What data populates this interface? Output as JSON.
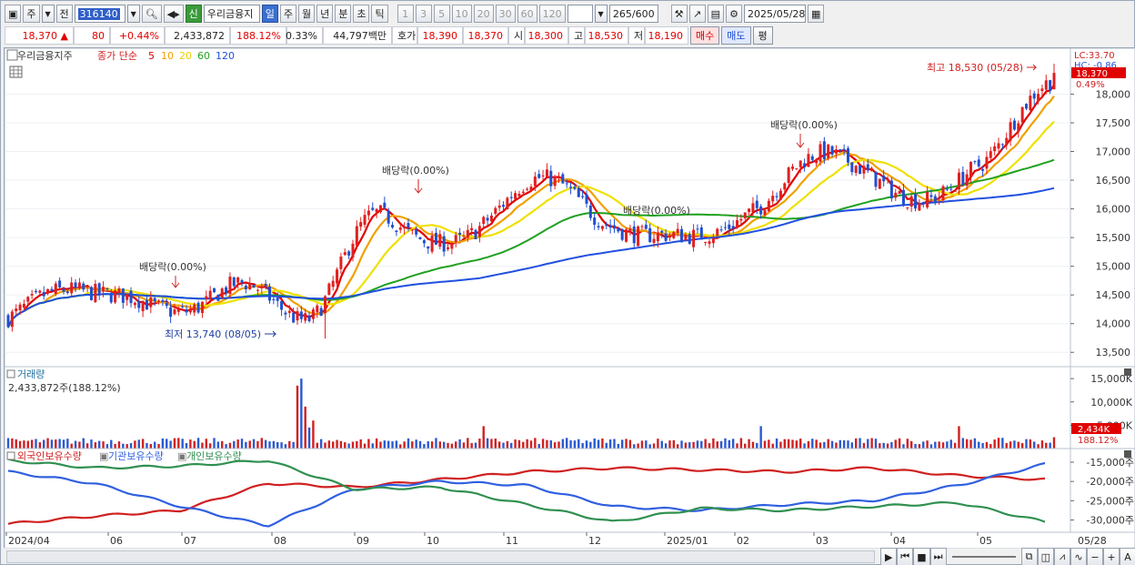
{
  "toolbar": {
    "period_weekly": "주",
    "view_all": "전",
    "stock_code": "316140",
    "new_tag": "신",
    "stock_name": "우리금융지",
    "periods": [
      "일",
      "주",
      "월",
      "년",
      "분",
      "초",
      "틱"
    ],
    "minutes": [
      "1",
      "3",
      "5",
      "10",
      "20",
      "30",
      "60",
      "120"
    ],
    "count": "265",
    "count_total": "/600",
    "date": "2025/05/28"
  },
  "quote": {
    "price": "18,370",
    "change_arrow": "▲",
    "change": "80",
    "change_pct": "+0.44%",
    "volume": "2,433,872",
    "volume_ratio": "188.12%",
    "turnover_pct": "0.33%",
    "amount": "44,797백만",
    "bid_label": "호가",
    "bid1": "18,390",
    "bid2": "18,370",
    "open_label": "시",
    "open": "18,300",
    "high_label": "고",
    "high": "18,530",
    "low_label": "저",
    "low": "18,190",
    "buy_label": "매수",
    "sell_label": "매도",
    "avg_label": "평"
  },
  "price_panel": {
    "legend_name": "우리금융지주",
    "legend_type": "종가 단순",
    "ma_labels": [
      "5",
      "10",
      "20",
      "60",
      "120"
    ],
    "ma_colors": [
      "#e00000",
      "#f0a000",
      "#f0e000",
      "#20a020",
      "#2050e0"
    ],
    "corner_lc": "LC:33.70",
    "corner_hc": "HC: -0.86",
    "last_price_label": "18,370",
    "last_pct_label": "0.49%",
    "high_annotation": "최고 18,530 (05/28)",
    "low_annotation": "최저 13,740 (08/05)",
    "dividend_label": "배당락(0.00%)"
  },
  "volume_panel": {
    "title": "거래량",
    "current": "2,433,872주(188.12%)",
    "last_label": "2,434K",
    "last_pct": "188.12%"
  },
  "holding_panel": {
    "series": [
      {
        "name": "외국인보유수량",
        "color": "#d02020"
      },
      {
        "name": "기관보유수량",
        "color": "#3060e0"
      },
      {
        "name": "개인보유수량",
        "color": "#309050"
      }
    ]
  },
  "x_axis": [
    "2024/04",
    "06",
    "07",
    "08",
    "09",
    "10",
    "11",
    "12",
    "2025/01",
    "02",
    "03",
    "04",
    "05"
  ],
  "x_axis_right": "05/28",
  "chart_data": [
    {
      "type": "candlestick",
      "title": "우리금융지주",
      "yticks": [
        13500,
        14000,
        14500,
        15000,
        15500,
        16000,
        16500,
        17000,
        17500,
        18000
      ],
      "ylim": [
        13250,
        18800
      ],
      "dates": [
        "2024/04",
        "05",
        "06",
        "07",
        "08",
        "09",
        "10",
        "11",
        "12",
        "2025/01",
        "02",
        "03",
        "04",
        "05",
        "05/28"
      ],
      "close": [
        14100,
        14700,
        14200,
        14600,
        14200,
        15900,
        15300,
        16600,
        15800,
        15400,
        16000,
        17100,
        16100,
        16700,
        18370
      ],
      "high_point": {
        "date": "05/28",
        "value": 18530
      },
      "low_point": {
        "date": "08/05",
        "value": 13740
      },
      "ma": [
        "5",
        "10",
        "20",
        "60",
        "120"
      ]
    },
    {
      "type": "bar",
      "title": "거래량",
      "yticks": [
        "5,000K",
        "10,000K",
        "15,000K"
      ],
      "ylim": [
        0,
        16000
      ],
      "last_value": 2433872
    },
    {
      "type": "line",
      "title": "외국인보유수량 / 기관보유수량 / 개인보유수량",
      "yticks": [
        "-15,000주",
        "-20,000주",
        "-25,000주",
        "-30,000주"
      ],
      "series": [
        {
          "name": "외국인보유수량",
          "values": [
            -31000,
            -29000,
            -27500,
            -20500,
            -21500,
            -19500,
            -17500,
            -16500,
            -17000,
            -17500,
            -16500,
            -18500,
            -19500
          ]
        },
        {
          "name": "기관보유수량",
          "values": [
            -17500,
            -20500,
            -26500,
            -31500,
            -22000,
            -20000,
            -21000,
            -26500,
            -27500,
            -26000,
            -25000,
            -21000,
            -15500
          ]
        },
        {
          "name": "개인보유수량",
          "values": [
            -14500,
            -16500,
            -16000,
            -14500,
            -22000,
            -21500,
            -26000,
            -30500,
            -27000,
            -27500,
            -26500,
            -25500,
            -30500
          ]
        }
      ]
    }
  ]
}
